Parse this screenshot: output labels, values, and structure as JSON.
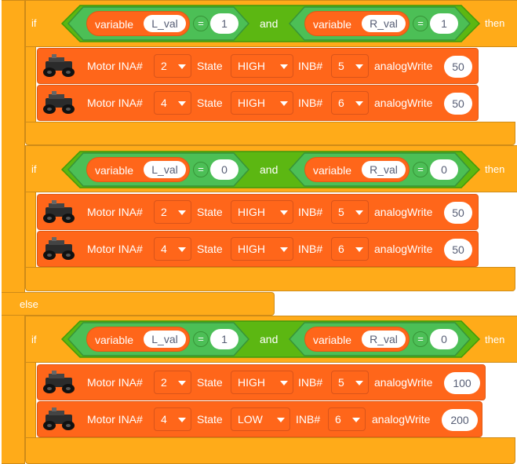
{
  "keywords": {
    "if": "if",
    "then": "then",
    "else": "else",
    "and": "and"
  },
  "var_label": "variable",
  "eq_label": "=",
  "motor": {
    "label": "Motor INA#",
    "state_label": "State",
    "inb_label": "INB#",
    "aw_label": "analogWrite"
  },
  "blocks": [
    {
      "cond": {
        "left": {
          "var": "L_val",
          "value": "1"
        },
        "right": {
          "var": "R_val",
          "value": "1"
        }
      },
      "motors": [
        {
          "ina": "2",
          "state": "HIGH",
          "inb": "5",
          "aw": "50"
        },
        {
          "ina": "4",
          "state": "HIGH",
          "inb": "6",
          "aw": "50"
        }
      ]
    },
    {
      "cond": {
        "left": {
          "var": "L_val",
          "value": "0"
        },
        "right": {
          "var": "R_val",
          "value": "0"
        }
      },
      "motors": [
        {
          "ina": "2",
          "state": "HIGH",
          "inb": "5",
          "aw": "50"
        },
        {
          "ina": "4",
          "state": "HIGH",
          "inb": "6",
          "aw": "50"
        }
      ]
    },
    {
      "cond": {
        "left": {
          "var": "L_val",
          "value": "1"
        },
        "right": {
          "var": "R_val",
          "value": "0"
        }
      },
      "motors": [
        {
          "ina": "2",
          "state": "HIGH",
          "inb": "5",
          "aw": "100"
        },
        {
          "ina": "4",
          "state": "LOW",
          "inb": "6",
          "aw": "200"
        }
      ]
    }
  ],
  "colors": {
    "control": "#ffab19",
    "operator": "#5cb712",
    "variable": "#ff661a",
    "motor": "#ff661a"
  }
}
